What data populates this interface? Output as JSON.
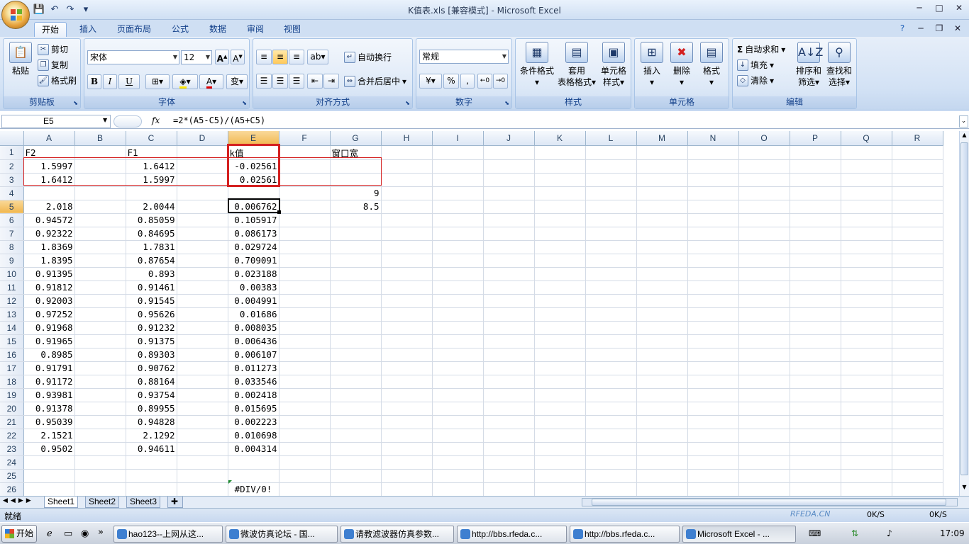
{
  "window": {
    "title": "K值表.xls  [兼容模式] - Microsoft Excel"
  },
  "tabs": [
    "开始",
    "插入",
    "页面布局",
    "公式",
    "数据",
    "审阅",
    "视图"
  ],
  "ribbon": {
    "clipboard": {
      "paste": "粘贴",
      "cut": "剪切",
      "copy": "复制",
      "format_painter": "格式刷",
      "label": "剪贴板"
    },
    "font": {
      "name": "宋体",
      "size": "12",
      "bold": "B",
      "italic": "I",
      "underline": "U",
      "label": "字体"
    },
    "alignment": {
      "wrap": "自动换行",
      "merge": "合并后居中",
      "label": "对齐方式"
    },
    "number": {
      "format": "常规",
      "label": "数字"
    },
    "styles": {
      "conditional": "条件格式",
      "table_1": "套用",
      "table_2": "表格格式",
      "cell_1": "单元格",
      "cell_2": "样式",
      "label": "样式"
    },
    "cells": {
      "insert": "插入",
      "delete": "删除",
      "format": "格式",
      "label": "单元格"
    },
    "editing": {
      "autosum": "自动求和",
      "fill": "填充",
      "clear": "清除",
      "sort_1": "排序和",
      "sort_2": "筛选",
      "find_1": "查找和",
      "find_2": "选择",
      "label": "编辑"
    }
  },
  "formula_bar": {
    "name_box": "E5",
    "fx": "fx",
    "formula": "=2*(A5-C5)/(A5+C5)"
  },
  "columns": [
    "A",
    "B",
    "C",
    "D",
    "E",
    "F",
    "G",
    "H",
    "I",
    "J",
    "K",
    "L",
    "M",
    "N",
    "O",
    "P",
    "Q",
    "R"
  ],
  "rows": [
    {
      "n": "1",
      "A": "F2",
      "B": "",
      "C": "F1",
      "D": "",
      "E": "k值",
      "F": "",
      "G": "窗口宽"
    },
    {
      "n": "2",
      "A": "1.5997",
      "B": "",
      "C": "1.6412",
      "D": "",
      "E": "-0.02561",
      "F": "",
      "G": ""
    },
    {
      "n": "3",
      "A": "1.6412",
      "B": "",
      "C": "1.5997",
      "D": "",
      "E": "0.02561",
      "F": "",
      "G": ""
    },
    {
      "n": "4",
      "A": "",
      "B": "",
      "C": "",
      "D": "",
      "E": "",
      "F": "",
      "G": "9"
    },
    {
      "n": "5",
      "A": "2.018",
      "B": "",
      "C": "2.0044",
      "D": "",
      "E": "0.006762",
      "F": "",
      "G": "8.5"
    },
    {
      "n": "6",
      "A": "0.94572",
      "B": "",
      "C": "0.85059",
      "D": "",
      "E": "0.105917",
      "F": "",
      "G": ""
    },
    {
      "n": "7",
      "A": "0.92322",
      "B": "",
      "C": "0.84695",
      "D": "",
      "E": "0.086173",
      "F": "",
      "G": ""
    },
    {
      "n": "8",
      "A": "1.8369",
      "B": "",
      "C": "1.7831",
      "D": "",
      "E": "0.029724",
      "F": "",
      "G": ""
    },
    {
      "n": "9",
      "A": "1.8395",
      "B": "",
      "C": "0.87654",
      "D": "",
      "E": "0.709091",
      "F": "",
      "G": ""
    },
    {
      "n": "10",
      "A": "0.91395",
      "B": "",
      "C": "0.893",
      "D": "",
      "E": "0.023188",
      "F": "",
      "G": ""
    },
    {
      "n": "11",
      "A": "0.91812",
      "B": "",
      "C": "0.91461",
      "D": "",
      "E": "0.00383",
      "F": "",
      "G": ""
    },
    {
      "n": "12",
      "A": "0.92003",
      "B": "",
      "C": "0.91545",
      "D": "",
      "E": "0.004991",
      "F": "",
      "G": ""
    },
    {
      "n": "13",
      "A": "0.97252",
      "B": "",
      "C": "0.95626",
      "D": "",
      "E": "0.01686",
      "F": "",
      "G": ""
    },
    {
      "n": "14",
      "A": "0.91968",
      "B": "",
      "C": "0.91232",
      "D": "",
      "E": "0.008035",
      "F": "",
      "G": ""
    },
    {
      "n": "15",
      "A": "0.91965",
      "B": "",
      "C": "0.91375",
      "D": "",
      "E": "0.006436",
      "F": "",
      "G": ""
    },
    {
      "n": "16",
      "A": "0.8985",
      "B": "",
      "C": "0.89303",
      "D": "",
      "E": "0.006107",
      "F": "",
      "G": ""
    },
    {
      "n": "17",
      "A": "0.91791",
      "B": "",
      "C": "0.90762",
      "D": "",
      "E": "0.011273",
      "F": "",
      "G": ""
    },
    {
      "n": "18",
      "A": "0.91172",
      "B": "",
      "C": "0.88164",
      "D": "",
      "E": "0.033546",
      "F": "",
      "G": ""
    },
    {
      "n": "19",
      "A": "0.93981",
      "B": "",
      "C": "0.93754",
      "D": "",
      "E": "0.002418",
      "F": "",
      "G": ""
    },
    {
      "n": "20",
      "A": "0.91378",
      "B": "",
      "C": "0.89955",
      "D": "",
      "E": "0.015695",
      "F": "",
      "G": ""
    },
    {
      "n": "21",
      "A": "0.95039",
      "B": "",
      "C": "0.94828",
      "D": "",
      "E": "0.002223",
      "F": "",
      "G": ""
    },
    {
      "n": "22",
      "A": "2.1521",
      "B": "",
      "C": "2.1292",
      "D": "",
      "E": "0.010698",
      "F": "",
      "G": ""
    },
    {
      "n": "23",
      "A": "0.9502",
      "B": "",
      "C": "0.94611",
      "D": "",
      "E": "0.004314",
      "F": "",
      "G": ""
    },
    {
      "n": "24",
      "A": "",
      "B": "",
      "C": "",
      "D": "",
      "E": "",
      "F": "",
      "G": ""
    },
    {
      "n": "25",
      "A": "",
      "B": "",
      "C": "",
      "D": "",
      "E": "",
      "F": "",
      "G": ""
    },
    {
      "n": "26",
      "A": "",
      "B": "",
      "C": "",
      "D": "",
      "E": "#DIV/0!",
      "F": "",
      "G": ""
    }
  ],
  "sheets": [
    "Sheet1",
    "Sheet2",
    "Sheet3"
  ],
  "status": {
    "ready": "就绪"
  },
  "taskbar": {
    "start": "开始",
    "items": [
      "hao123--上网从这...",
      "微波仿真论坛 - 国...",
      "请教滤波器仿真参数...",
      "http://bbs.rfeda.c...",
      "http://bbs.rfeda.c...",
      "Microsoft Excel - ..."
    ],
    "clock": "17:09",
    "net1": "0K/S",
    "net2": "0K/S"
  },
  "watermark": "RFEDA.CN",
  "colors": {
    "ribbon": "#d3e2f5",
    "selected_header": "#f1b74f",
    "annotation_red": "#d42020"
  }
}
